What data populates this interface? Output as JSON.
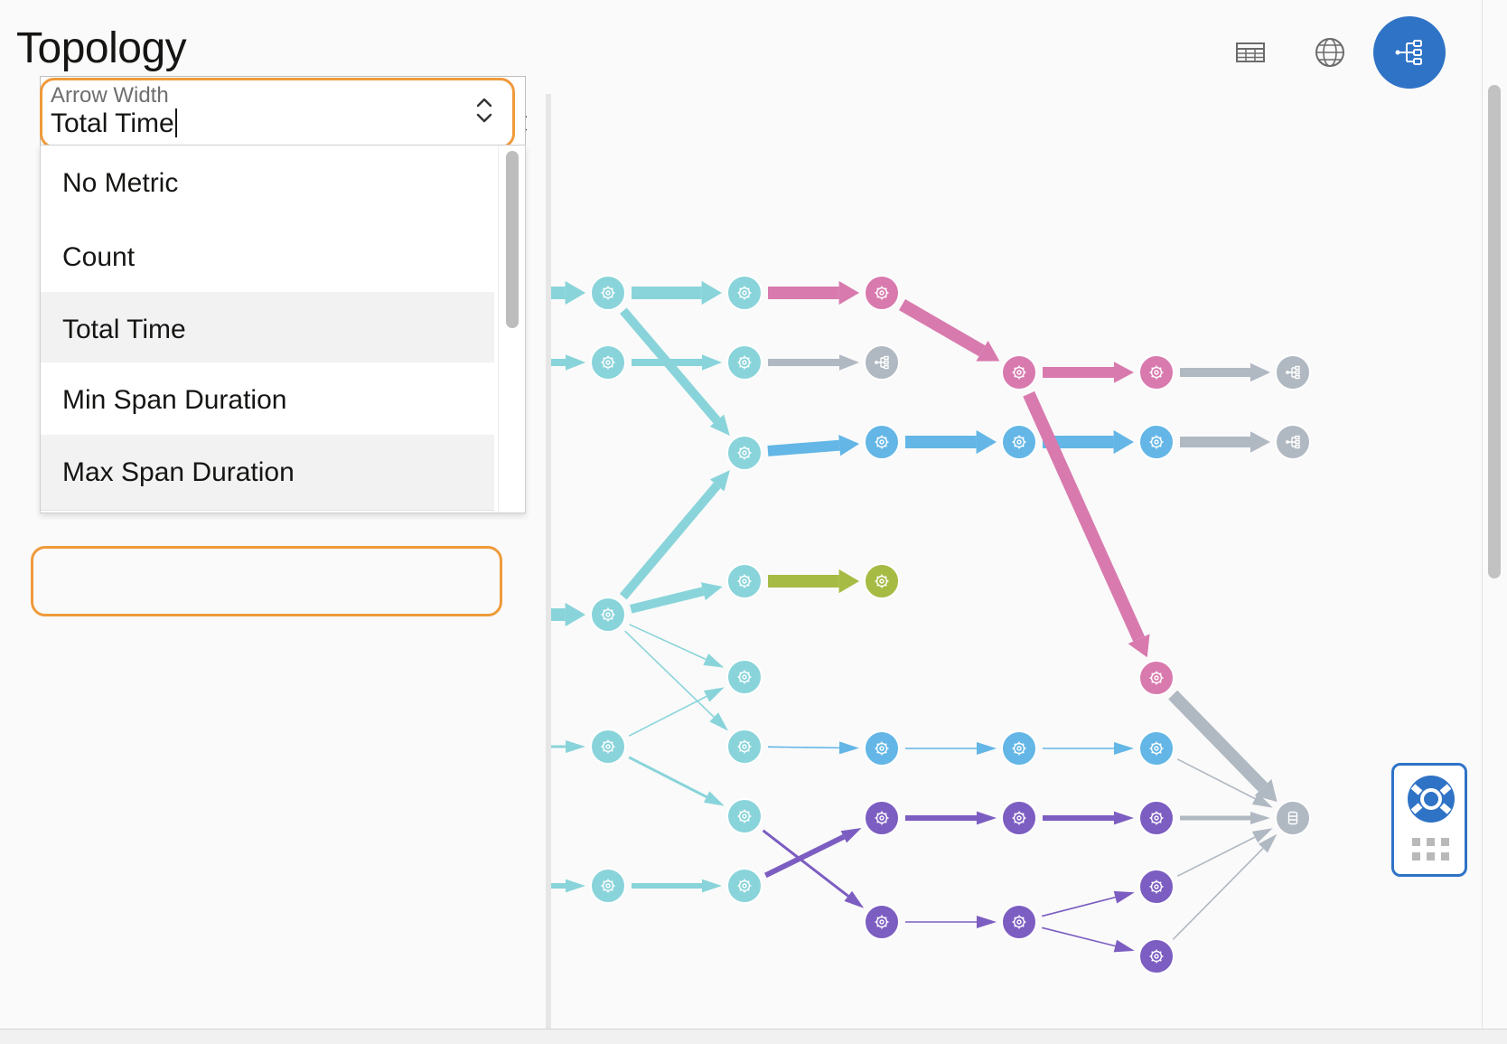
{
  "page": {
    "title": "Topology"
  },
  "header_actions": [
    {
      "name": "table-view",
      "icon": "table-icon"
    },
    {
      "name": "map-view",
      "icon": "globe-icon"
    },
    {
      "name": "topology-view",
      "icon": "topology-icon",
      "active": true
    }
  ],
  "panel": {
    "tabs": [
      {
        "name": "topology",
        "icon": "topology-icon"
      },
      {
        "name": "settings",
        "icon": "gear-icon",
        "active": true
      }
    ],
    "close_icon": "close-icon",
    "select": {
      "label": "Arrow Width",
      "value": "Total Time"
    },
    "options": [
      {
        "label": "No Metric"
      },
      {
        "label": "Count"
      },
      {
        "label": "Total Time",
        "selected": true
      },
      {
        "label": "Min Span Duration"
      },
      {
        "label": "Max Span Duration"
      }
    ]
  },
  "colors": {
    "accent": "#2f73c6",
    "highlight": "#ef9a3b",
    "teal": "#89d4da",
    "blue": "#63b6e6",
    "pink": "#d87aae",
    "purple": "#7c5dc1",
    "green": "#a6bb43",
    "gray": "#b0b8c2"
  },
  "help_widget": {
    "icon": "lifebuoy-icon",
    "secondary_icon": "grid-icon"
  }
}
